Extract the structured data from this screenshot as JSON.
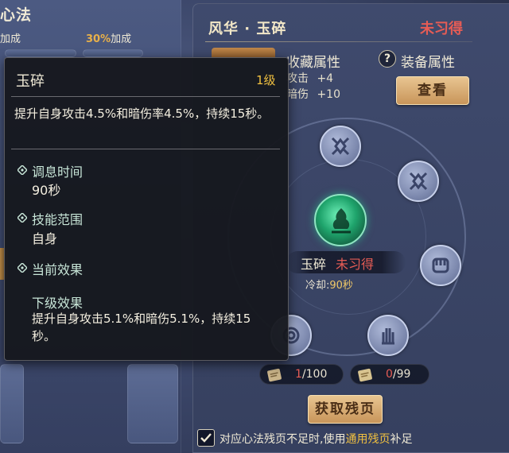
{
  "left": {
    "title": "心法",
    "row_label": "加成",
    "row_percent": "30%",
    "row_suffix": "加成"
  },
  "panel": {
    "title": "风华 · 玉碎",
    "status": "未习得",
    "collect_title": "收藏属性",
    "collect_rows": [
      {
        "label": "攻击",
        "value": "+4"
      },
      {
        "label": "暗伤",
        "value": "+10"
      }
    ],
    "equip_title": "装备属性",
    "view_button": "查看"
  },
  "wheel": {
    "skill_name": "玉碎",
    "skill_state": "未习得",
    "cooldown_label": "冷却:",
    "cooldown_value": "90秒"
  },
  "counters": [
    {
      "have": "1",
      "total": "/100"
    },
    {
      "have": "0",
      "total": "/99"
    }
  ],
  "get_button": "获取残页",
  "auto_fill": {
    "checked": true,
    "text_before": "对应心法残页不足时,使用",
    "highlight": "通用残页",
    "text_after": "补足"
  },
  "tooltip": {
    "name": "玉碎",
    "level": "1级",
    "description": "提升自身攻击4.5%和暗伤率4.5%，持续15秒。",
    "sections": [
      {
        "heading": "调息时间",
        "value": "90秒"
      },
      {
        "heading": "技能范围",
        "value": "自身"
      },
      {
        "heading": "当前效果",
        "value": ""
      }
    ],
    "next_heading": "下级效果",
    "next_description": "提升自身攻击5.1%和暗伤5.1%，持续15秒。"
  },
  "colors": {
    "status_red": "#e65c55",
    "gold": "#f0c040",
    "button_gold": "#d9ad74"
  },
  "icons": [
    "help-icon",
    "skill-jade-icon",
    "page-scroll-icon",
    "checkmark-icon",
    "diamond-bullet-icon"
  ]
}
